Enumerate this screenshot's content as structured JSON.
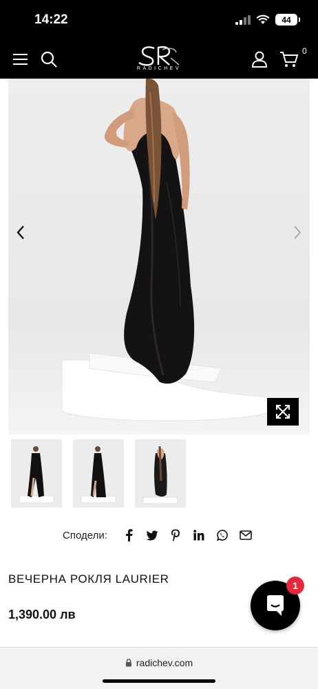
{
  "status": {
    "time": "14:22",
    "battery": "44"
  },
  "header": {
    "brand_sub": "RADICHEV",
    "cart_count": "0"
  },
  "share": {
    "label": "Сподели:"
  },
  "product": {
    "title": "ВЕЧЕРНА РОКЛЯ LAURIER",
    "price": "1,390.00 лв"
  },
  "chat": {
    "badge": "1"
  },
  "browser": {
    "url": "radichev.com"
  },
  "icons": [
    "menu-icon",
    "search-icon",
    "user-icon",
    "cart-icon",
    "chevron-left-icon",
    "chevron-right-icon",
    "expand-icon",
    "facebook-icon",
    "twitter-icon",
    "pinterest-icon",
    "linkedin-icon",
    "whatsapp-icon",
    "email-icon",
    "chat-icon",
    "lock-icon"
  ],
  "colors": {
    "header_bg": "#000000",
    "badge": "#e4283d",
    "gallery_bg": "#ebebeb"
  }
}
